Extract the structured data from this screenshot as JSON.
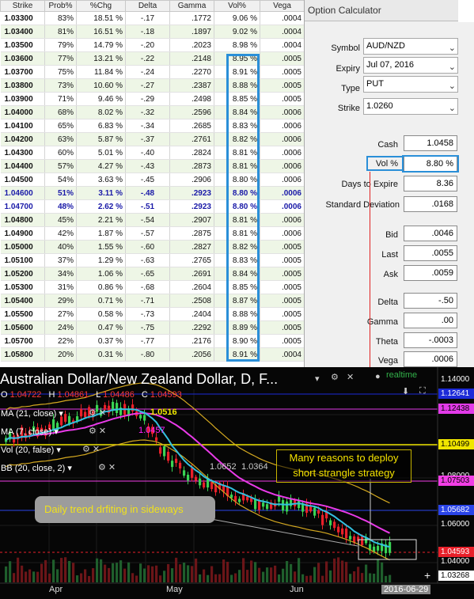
{
  "table": {
    "headers": [
      "Strike",
      "Prob%",
      "%Chg",
      "Delta",
      "Gamma",
      "Vol%",
      "Vega"
    ],
    "rows": [
      [
        "1.03300",
        "83%",
        "18.51 %",
        "-.17",
        ".1772",
        "9.06 %",
        ".0004"
      ],
      [
        "1.03400",
        "81%",
        "16.51 %",
        "-.18",
        ".1897",
        "9.02 %",
        ".0004"
      ],
      [
        "1.03500",
        "79%",
        "14.79 %",
        "-.20",
        ".2023",
        "8.98 %",
        ".0004"
      ],
      [
        "1.03600",
        "77%",
        "13.21 %",
        "-.22",
        ".2148",
        "8.95 %",
        ".0005"
      ],
      [
        "1.03700",
        "75%",
        "11.84 %",
        "-.24",
        ".2270",
        "8.91 %",
        ".0005"
      ],
      [
        "1.03800",
        "73%",
        "10.60 %",
        "-.27",
        ".2387",
        "8.88 %",
        ".0005"
      ],
      [
        "1.03900",
        "71%",
        "9.46 %",
        "-.29",
        ".2498",
        "8.85 %",
        ".0005"
      ],
      [
        "1.04000",
        "68%",
        "8.02 %",
        "-.32",
        ".2596",
        "8.84 %",
        ".0006"
      ],
      [
        "1.04100",
        "65%",
        "6.83 %",
        "-.34",
        ".2685",
        "8.83 %",
        ".0006"
      ],
      [
        "1.04200",
        "63%",
        "5.87 %",
        "-.37",
        ".2761",
        "8.82 %",
        ".0006"
      ],
      [
        "1.04300",
        "60%",
        "5.01 %",
        "-.40",
        ".2824",
        "8.81 %",
        ".0006"
      ],
      [
        "1.04400",
        "57%",
        "4.27 %",
        "-.43",
        ".2873",
        "8.81 %",
        ".0006"
      ],
      [
        "1.04500",
        "54%",
        "3.63 %",
        "-.45",
        ".2906",
        "8.80 %",
        ".0006"
      ],
      [
        "1.04600",
        "51%",
        "3.11 %",
        "-.48",
        ".2923",
        "8.80 %",
        ".0006"
      ],
      [
        "1.04700",
        "48%",
        "2.62 %",
        "-.51",
        ".2923",
        "8.80 %",
        ".0006"
      ],
      [
        "1.04800",
        "45%",
        "2.21 %",
        "-.54",
        ".2907",
        "8.81 %",
        ".0006"
      ],
      [
        "1.04900",
        "42%",
        "1.87 %",
        "-.57",
        ".2875",
        "8.81 %",
        ".0006"
      ],
      [
        "1.05000",
        "40%",
        "1.55 %",
        "-.60",
        ".2827",
        "8.82 %",
        ".0005"
      ],
      [
        "1.05100",
        "37%",
        "1.29 %",
        "-.63",
        ".2765",
        "8.83 %",
        ".0005"
      ],
      [
        "1.05200",
        "34%",
        "1.06 %",
        "-.65",
        ".2691",
        "8.84 %",
        ".0005"
      ],
      [
        "1.05300",
        "31%",
        "0.86 %",
        "-.68",
        ".2604",
        "8.85 %",
        ".0005"
      ],
      [
        "1.05400",
        "29%",
        "0.71 %",
        "-.71",
        ".2508",
        "8.87 %",
        ".0005"
      ],
      [
        "1.05500",
        "27%",
        "0.58 %",
        "-.73",
        ".2404",
        "8.88 %",
        ".0005"
      ],
      [
        "1.05600",
        "24%",
        "0.47 %",
        "-.75",
        ".2292",
        "8.89 %",
        ".0005"
      ],
      [
        "1.05700",
        "22%",
        "0.37 %",
        "-.77",
        ".2176",
        "8.90 %",
        ".0005"
      ],
      [
        "1.05800",
        "20%",
        "0.31 %",
        "-.80",
        ".2056",
        "8.91 %",
        ".0004"
      ]
    ],
    "highlighted_rows": [
      13,
      14
    ]
  },
  "calculator": {
    "title": "Option Calculator",
    "symbol_label": "Symbol",
    "symbol_value": "AUD/NZD",
    "expiry_label": "Expiry",
    "expiry_value": "Jul 07, 2016",
    "type_label": "Type",
    "type_value": "PUT",
    "strike_label": "Strike",
    "strike_value": "1.0260",
    "cash_label": "Cash",
    "cash_value": "1.0458",
    "vol_label": "Vol %",
    "vol_value": "8.80 %",
    "days_label": "Days to Expire",
    "days_value": "8.36",
    "sd_label": "Standard Deviation",
    "sd_value": ".0168",
    "bid_label": "Bid",
    "bid_value": ".0046",
    "last_label": "Last",
    "last_value": ".0055",
    "ask_label": "Ask",
    "ask_value": ".0059",
    "delta_label": "Delta",
    "delta_value": "-.50",
    "gamma_label": "Gamma",
    "gamma_value": ".00",
    "theta_label": "Theta",
    "theta_value": "-.0003",
    "vega_label": "Vega",
    "vega_value": ".0006"
  },
  "chart": {
    "title": "Australian Dollar/New Zealand Dollar, D, F...",
    "realtime": "realtime",
    "ohlc": {
      "o_label": "O",
      "o": "1.04722",
      "h_label": "H",
      "h": "1.04861",
      "l_label": "L",
      "l": "1.04486",
      "c_label": "C",
      "c": "1.04593"
    },
    "indicators": [
      "MA (21, close)",
      "MA (7, close)",
      "Vol (20, false)",
      "BB (20, close, 2)"
    ],
    "indicator_values": [
      "1.0516",
      "1.0457",
      "1.0652",
      "1.0364"
    ],
    "price_scale": [
      "1.14000",
      "1.12000",
      "1.10000",
      "1.08000",
      "1.06000",
      "1.04000"
    ],
    "price_tags": [
      {
        "text": "1.12641",
        "color": "#1c2ad8"
      },
      {
        "text": "1.12438",
        "color": "#e23ae8"
      },
      {
        "text": "1.10499",
        "color": "#f0e600"
      },
      {
        "text": "1.07503",
        "color": "#f23ee6"
      },
      {
        "text": "1.05682",
        "color": "#2a44e8"
      },
      {
        "text": "1.04593",
        "color": "#e8202a"
      },
      {
        "text": "1.03268",
        "color": "#ffffff"
      }
    ],
    "x_labels": [
      "Apr",
      "May",
      "Jun",
      "2016-06-29"
    ],
    "annotation_1": "Many reasons to deploy short strangle strategy",
    "annotation_2": "Daily trend drfiting in sideways",
    "colors": {
      "bull": "#39d353",
      "bear": "#e8202a",
      "ma21": "#e93ae8",
      "ma7": "#33c0e0",
      "bb": "#d4a820",
      "vol": "#2a8fd8"
    }
  }
}
